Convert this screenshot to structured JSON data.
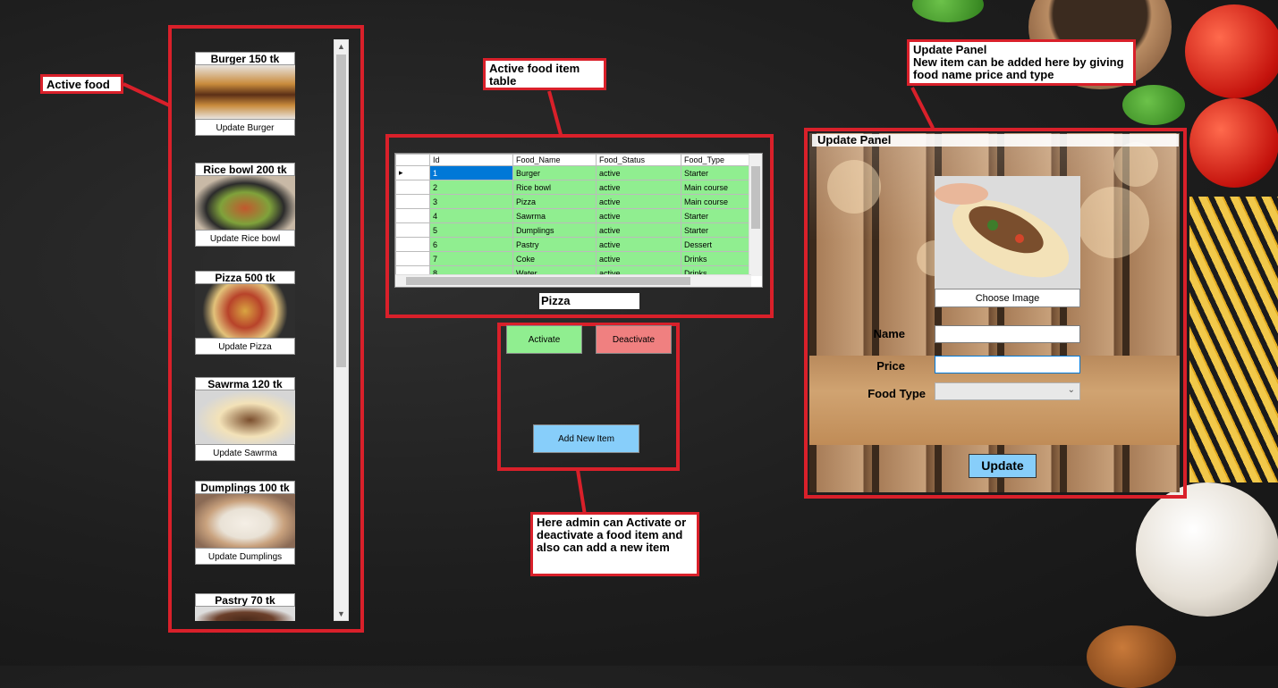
{
  "annotations": {
    "active_food": "Active food",
    "active_table": "Active food item table",
    "update_panel": "Update Panel\nNew item can be added here by giving food name price and type",
    "admin_actions": "Here admin can Activate or deactivate a food item and also can add a new item"
  },
  "food_list": [
    {
      "title": "Burger 150 tk",
      "button": "Update Burger",
      "img": "burger"
    },
    {
      "title": "Rice bowl 200 tk",
      "button": "Update Rice bowl",
      "img": "rice"
    },
    {
      "title": "Pizza 500 tk",
      "button": "Update Pizza",
      "img": "pizza"
    },
    {
      "title": "Sawrma 120 tk",
      "button": "Update Sawrma",
      "img": "sawrma"
    },
    {
      "title": "Dumplings 100 tk",
      "button": "Update Dumplings",
      "img": "dumplings"
    },
    {
      "title": "Pastry 70 tk",
      "button": "",
      "img": "pastry"
    }
  ],
  "table": {
    "columns": [
      "Id",
      "Food_Name",
      "Food_Status",
      "Food_Type"
    ],
    "rows": [
      [
        "1",
        "Burger",
        "active",
        "Starter"
      ],
      [
        "2",
        "Rice bowl",
        "active",
        "Main course"
      ],
      [
        "3",
        "Pizza",
        "active",
        "Main course"
      ],
      [
        "4",
        "Sawrma",
        "active",
        "Starter"
      ],
      [
        "5",
        "Dumplings",
        "active",
        "Starter"
      ],
      [
        "6",
        "Pastry",
        "active",
        "Dessert"
      ],
      [
        "7",
        "Coke",
        "active",
        "Drinks"
      ],
      [
        "8",
        "Water",
        "active",
        "Drinks"
      ]
    ],
    "selected_name": "Pizza"
  },
  "actions": {
    "activate": "Activate",
    "deactivate": "Deactivate",
    "add_new": "Add New Item"
  },
  "update_panel": {
    "title": "Update Panel",
    "choose_image": "Choose Image",
    "name_label": "Name",
    "price_label": "Price",
    "type_label": "Food Type",
    "name_value": "",
    "price_value": "",
    "type_value": "",
    "update_button": "Update"
  },
  "colors": {
    "highlight": "#d9202a",
    "activate": "#90ee90",
    "deactivate": "#f08080",
    "add_new": "#87cefa",
    "update": "#87cefa"
  }
}
